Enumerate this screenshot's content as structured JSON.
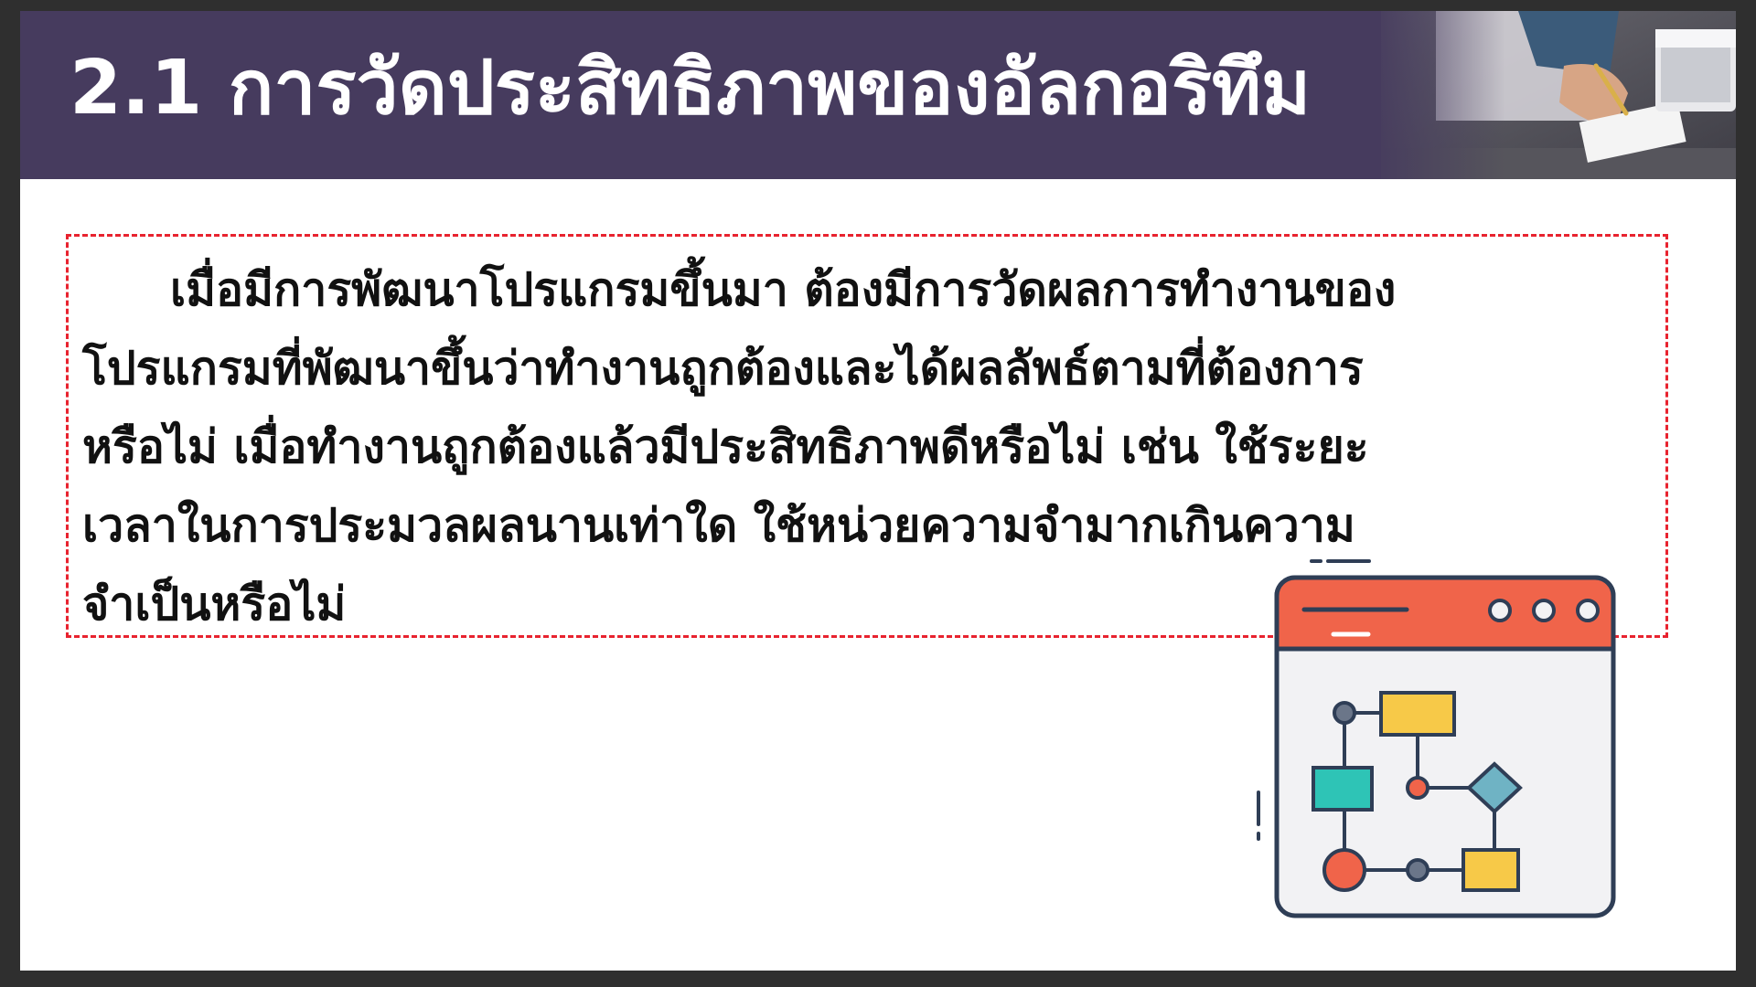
{
  "slide": {
    "title": "2.1 การวัดประสิทธิภาพของอัลกอริทึม",
    "paragraph_lines": [
      "เมื่อมีการพัฒนาโปรแกรมขึ้นมา ต้องมีการวัดผลการทำงานของ",
      "โปรแกรมที่พัฒนาขึ้นว่าทำงานถูกต้องและได้ผลลัพธ์ตามที่ต้องการ",
      "หรือไม่ เมื่อทำงานถูกต้องแล้วมีประสิทธิภาพดีหรือไม่ เช่น ใช้ระยะ",
      "เวลาในการประมวลผลนานเท่าใด ใช้หน่วยความจำมากเกินความ",
      "จำเป็นหรือไม่"
    ]
  },
  "colors": {
    "header_bg": "#463b5e",
    "title_text": "#ffffff",
    "dashed_border": "#e8232f",
    "window_bar": "#f0644a",
    "yellow_box": "#f7c948",
    "teal_box": "#2ec4b6",
    "diamond": "#6fb3c4",
    "outline": "#2f3e56"
  },
  "icons": {
    "header_photo": "person-writing-photo",
    "illustration": "flowchart-window-icon"
  }
}
